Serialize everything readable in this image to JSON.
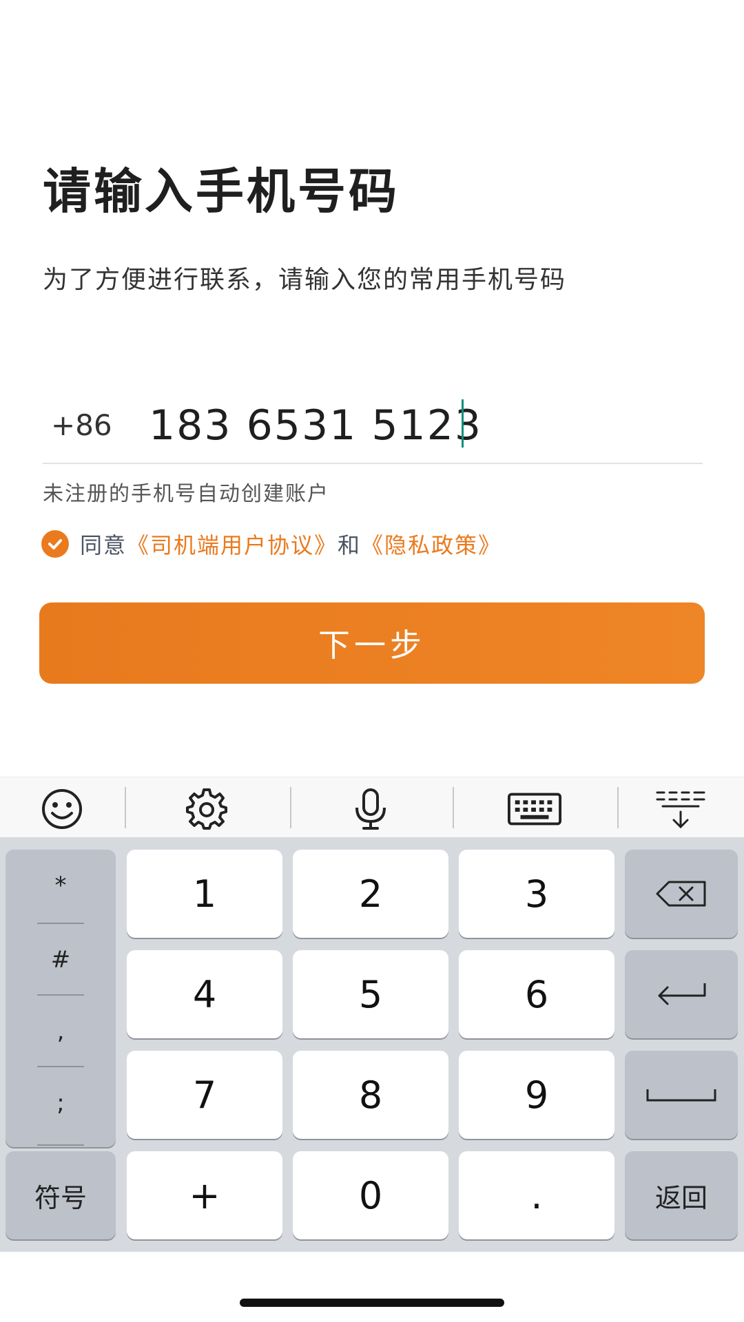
{
  "form": {
    "title": "请输入手机号码",
    "subtitle": "为了方便进行联系，请输入您的常用手机号码",
    "country_code": "+86",
    "phone_value": "183 6531 5123",
    "hint": "未注册的手机号自动创建账户",
    "agree_prefix": "同意",
    "agreement_link": "《司机端用户协议》",
    "agree_and": "和",
    "privacy_link": "《隐私政策》",
    "agreed": true,
    "next_label": "下一步"
  },
  "keyboard_toolbar": {
    "icons": [
      "emoji-icon",
      "gear-icon",
      "microphone-icon",
      "keyboard-icon",
      "hide-keyboard-icon"
    ]
  },
  "keyboard": {
    "symbols": [
      "*",
      "#",
      ",",
      ";"
    ],
    "rows": [
      [
        "1",
        "2",
        "3"
      ],
      [
        "4",
        "5",
        "6"
      ],
      [
        "7",
        "8",
        "9"
      ]
    ],
    "bottom": {
      "symbol_key": "符号",
      "plus": "+",
      "zero": "0",
      "dot": ".",
      "return_key": "返回"
    }
  },
  "colors": {
    "accent": "#ea7a1e",
    "caret": "#0f8f7a",
    "keyboard_bg": "#d6d9de",
    "gray_key": "#bcc1ca"
  }
}
